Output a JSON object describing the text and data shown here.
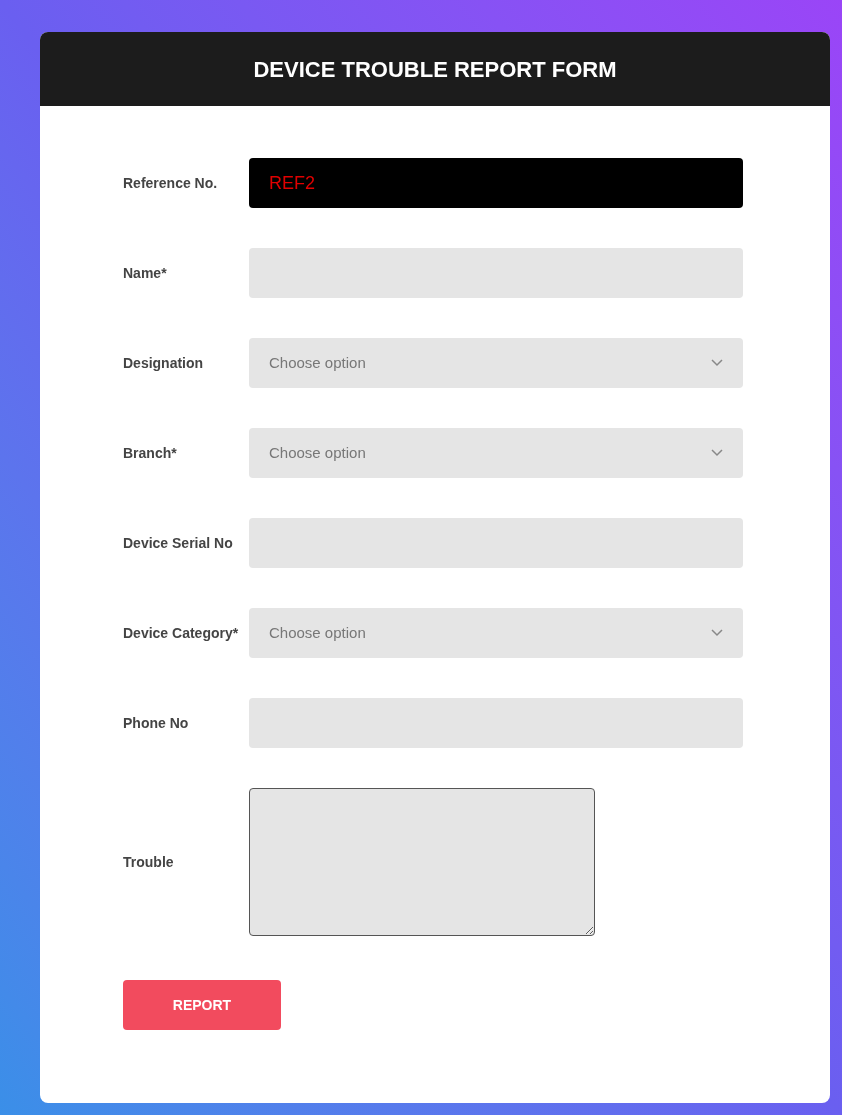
{
  "form": {
    "title": "DEVICE TROUBLE REPORT FORM",
    "fields": [
      {
        "label": "Reference No.",
        "kind": "readonly",
        "value": "REF2"
      },
      {
        "label": "Name*",
        "kind": "text"
      },
      {
        "label": "Designation",
        "kind": "select",
        "placeholder": "Choose option"
      },
      {
        "label": "Branch*",
        "kind": "select",
        "placeholder": "Choose option"
      },
      {
        "label": "Device Serial No",
        "kind": "text"
      },
      {
        "label": "Device Category*",
        "kind": "select",
        "placeholder": "Choose option"
      },
      {
        "label": "Phone No",
        "kind": "text"
      },
      {
        "label": "Trouble",
        "kind": "textarea"
      }
    ],
    "submit": "REPORT"
  }
}
